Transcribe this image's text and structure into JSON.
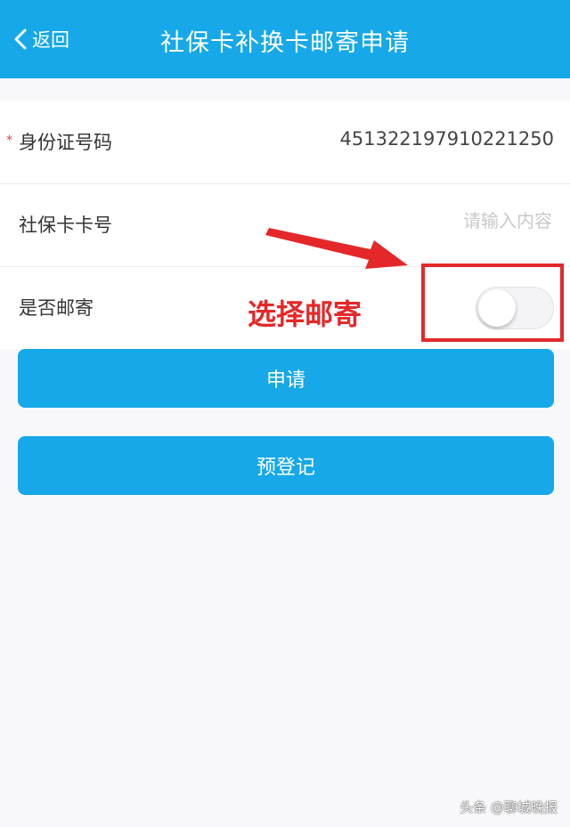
{
  "header": {
    "back_label": "返回",
    "title": "社保卡补换卡邮寄申请"
  },
  "form": {
    "id_card": {
      "required_mark": "*",
      "label": "身份证号码",
      "value": "451322197910221250"
    },
    "card_number": {
      "label": "社保卡卡号",
      "placeholder": "请输入内容",
      "value": ""
    },
    "mail": {
      "label": "是否邮寄",
      "enabled": false
    }
  },
  "annotation": {
    "text": "选择邮寄",
    "color": "#e4282a"
  },
  "buttons": {
    "apply": "申请",
    "pre_register": "预登记"
  },
  "watermark": "头条 @聊城晚报",
  "colors": {
    "primary": "#16a8e8",
    "annotation": "#e4282a"
  }
}
